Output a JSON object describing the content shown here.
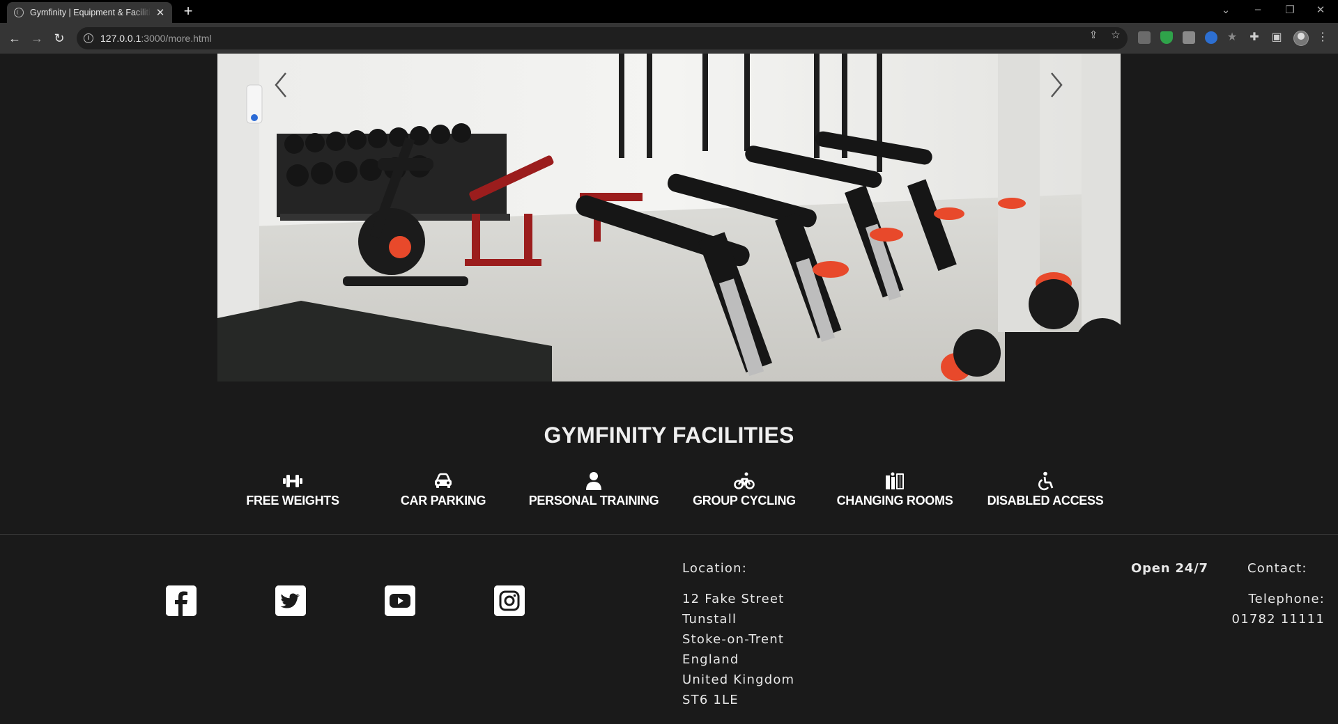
{
  "browser": {
    "tab_title": "Gymfinity | Equipment & Facilities",
    "tab_close": "✕",
    "new_tab": "+",
    "url_host": "127.0.0.1",
    "url_path": ":3000/more.html"
  },
  "facilities": {
    "heading": "GYMFINITY FACILITIES",
    "items": [
      {
        "label": "FREE WEIGHTS",
        "icon": "dumbbell-icon"
      },
      {
        "label": "CAR PARKING",
        "icon": "car-icon"
      },
      {
        "label": "PERSONAL TRAINING",
        "icon": "person-icon"
      },
      {
        "label": "GROUP CYCLING",
        "icon": "bicycle-icon"
      },
      {
        "label": "CHANGING ROOMS",
        "icon": "restroom-icon"
      },
      {
        "label": "DISABLED ACCESS",
        "icon": "wheelchair-icon"
      }
    ]
  },
  "footer": {
    "social": [
      "facebook-icon",
      "twitter-icon",
      "youtube-icon",
      "instagram-icon"
    ],
    "location_title": "Location:",
    "address": [
      "12 Fake Street",
      "Tunstall",
      "Stoke-on-Trent",
      "England",
      "United Kingdom",
      "ST6 1LE"
    ],
    "open_text": "Open 24/7",
    "contact_title": "Contact:",
    "telephone_label": "Telephone:",
    "telephone_number": "01782 11111"
  },
  "colors": {
    "page_bg": "#1a1a1a",
    "text": "#ffffff",
    "accent_equipment": "#e8492b"
  }
}
